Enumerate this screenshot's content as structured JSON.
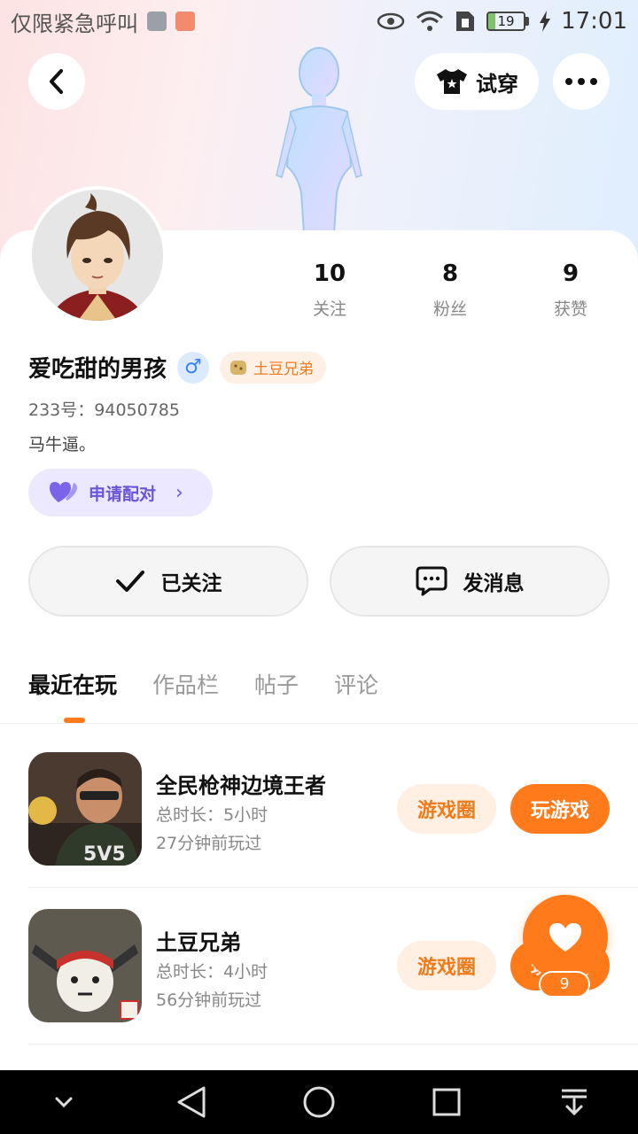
{
  "status_bar": {
    "carrier_text": "仅限紧急呼叫",
    "battery": "19",
    "time": "17:01"
  },
  "header": {
    "try_on_label": "试穿"
  },
  "profile": {
    "name": "爱吃甜的男孩",
    "gender_symbol": "♂",
    "badge": "土豆兄弟",
    "uid": "233号：94050785",
    "bio": "马牛逼。",
    "match_label": "申请配对"
  },
  "stats": [
    {
      "value": "10",
      "label": "关注"
    },
    {
      "value": "8",
      "label": "粉丝"
    },
    {
      "value": "9",
      "label": "获赞"
    }
  ],
  "actions": {
    "follow_label": "已关注",
    "message_label": "发消息"
  },
  "tabs": [
    {
      "label": "最近在玩",
      "active": true
    },
    {
      "label": "作品栏",
      "active": false
    },
    {
      "label": "帖子",
      "active": false
    },
    {
      "label": "评论",
      "active": false
    }
  ],
  "games": [
    {
      "title": "全民枪神边境王者",
      "duration": "总时长：5小时",
      "last_played": "27分钟前玩过",
      "circle_label": "游戏圈",
      "play_label": "玩游戏"
    },
    {
      "title": "土豆兄弟",
      "duration": "总时长：4小时",
      "last_played": "56分钟前玩过",
      "circle_label": "游戏圈",
      "play_label": "玩游戏"
    }
  ],
  "like_fab": {
    "count": "9"
  },
  "colors": {
    "accent": "#ff7a1a",
    "match_purple": "#6a55d8"
  }
}
